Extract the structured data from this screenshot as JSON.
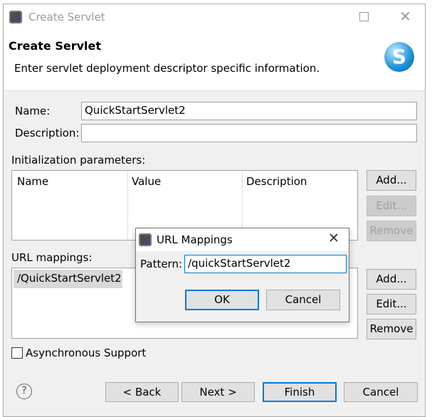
{
  "window": {
    "title": "Create Servlet",
    "maximize_icon": "square-icon",
    "close_icon": "x-icon"
  },
  "header": {
    "title": "Create Servlet",
    "subtitle": "Enter servlet deployment descriptor specific information.",
    "logo_icon": "servlet-s-icon"
  },
  "form": {
    "name_label": "Name:",
    "name_value": "QuickStartServlet2",
    "description_label": "Description:",
    "description_value": "",
    "init_label": "Initialization parameters:",
    "init_columns": [
      "Name",
      "Value",
      "Description"
    ],
    "init_buttons": {
      "add": "Add...",
      "edit": "Edit...",
      "remove": "Remove"
    },
    "url_label": "URL mappings:",
    "url_items": [
      "/QuickStartServlet2"
    ],
    "url_buttons": {
      "add": "Add...",
      "edit": "Edit...",
      "remove": "Remove"
    },
    "async_label": "Asynchronous Support",
    "async_checked": false
  },
  "footer": {
    "help_icon": "question-icon",
    "back": "< Back",
    "next": "Next >",
    "finish": "Finish",
    "cancel": "Cancel"
  },
  "popup": {
    "title": "URL Mappings",
    "pattern_label": "Pattern:",
    "pattern_value": "/quickStartServlet2",
    "ok": "OK",
    "cancel": "Cancel"
  },
  "colors": {
    "accent": "#0078d7",
    "selection": "#d9d9d9"
  }
}
